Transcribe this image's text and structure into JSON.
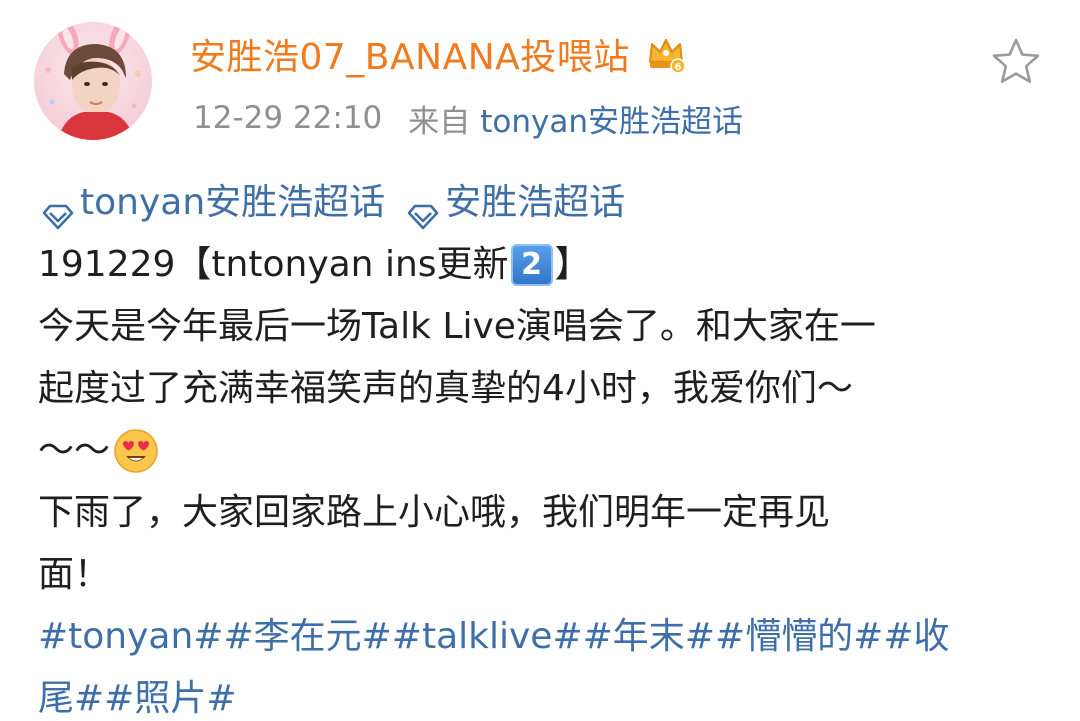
{
  "post": {
    "author": {
      "name": "安胜浩07_BANANA投喂站",
      "avatar": "avatar-photo",
      "badge": "crown-badge-icon"
    },
    "meta": {
      "time": "12-29 22:10",
      "from_label": "来自",
      "source": "tonyan安胜浩超话"
    },
    "favorite_icon": "star-outline-icon",
    "topics": [
      {
        "icon": "diamond-icon",
        "label": "tonyan安胜浩超话"
      },
      {
        "icon": "diamond-icon",
        "label": "安胜浩超话"
      }
    ],
    "headline": {
      "before": "191229【tntonyan ins更新",
      "keycap": "2",
      "after": "】"
    },
    "paragraph1": {
      "line1": "今天是今年最后一场Talk Live演唱会了。和大家在一",
      "line2": "起度过了充满幸福笑声的真挚的4小时，我爱你们～",
      "line3": "～～"
    },
    "paragraph2": {
      "line1": "下雨了，大家回家路上小心哦，我们明年一定再见",
      "line2": "面！"
    },
    "hashtags": {
      "line1": [
        "#tonyan#",
        "#李在元#",
        "#talklive#",
        "#年末#",
        "#懵懵的#",
        "#收"
      ],
      "line2": [
        "尾#",
        "#照片#"
      ]
    },
    "emoji": [
      "keycap-2-emoji",
      "heart-eyes-emoji"
    ],
    "colors": {
      "username": "#f07a1c",
      "link": "#3f6fa8",
      "meta": "#8f8f8f",
      "text": "#1f1f1f"
    }
  }
}
